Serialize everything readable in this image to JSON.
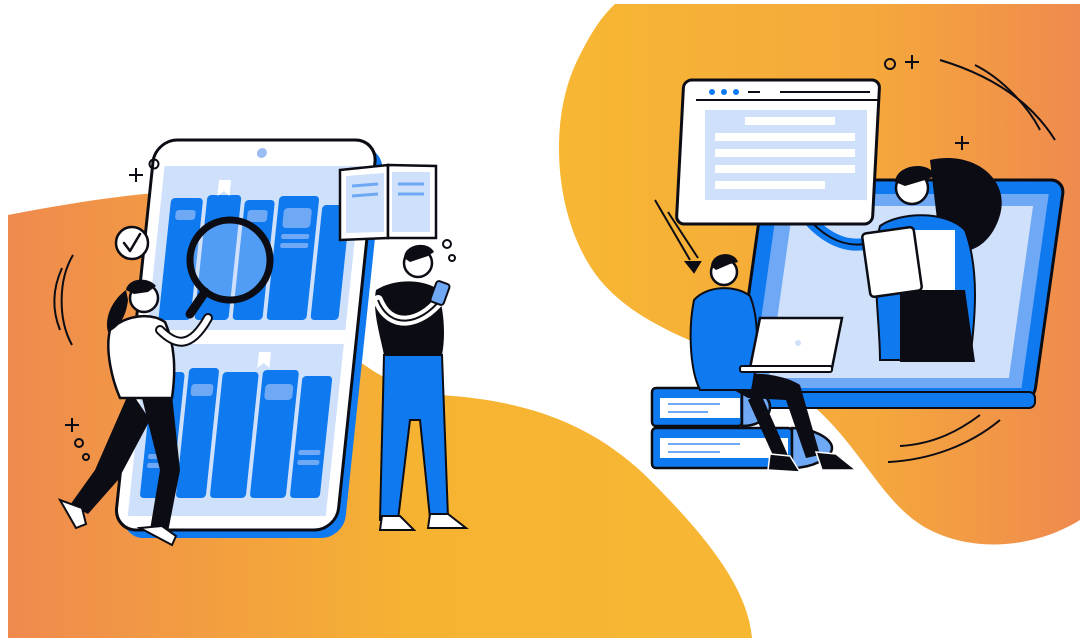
{
  "scene": {
    "left_panel": "online-library",
    "right_panel": "online-learning"
  },
  "colors": {
    "background": "#ffffff",
    "gradient_orange": "#EF8A4E",
    "gradient_yellow": "#F6B332",
    "brand_blue": "#0F79F0",
    "light_blue": "#CFE0FB",
    "mid_blue": "#6FA8F5",
    "ink": "#0C0C14",
    "cream": "#FFFFFF"
  },
  "icons": [
    "check-icon",
    "magnifier-icon",
    "book-icon",
    "bookmark-icon",
    "sparkle-icon",
    "play-icon",
    "laptop-icon",
    "smartphone-icon",
    "tablet-icon"
  ]
}
